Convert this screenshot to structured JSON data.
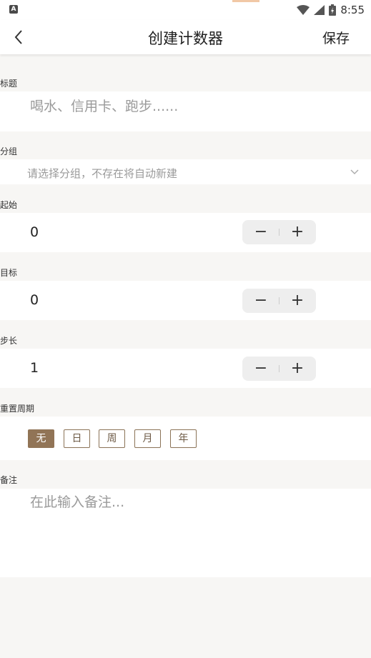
{
  "status_bar": {
    "time": "8:55",
    "left_icon": "A",
    "icons": [
      "wifi-icon",
      "signal-icon",
      "battery-icon"
    ]
  },
  "app_bar": {
    "title": "创建计数器",
    "save_label": "保存",
    "back_icon": "chevron-left-icon"
  },
  "form": {
    "title": {
      "label": "标题",
      "placeholder": "喝水、信用卡、跑步......"
    },
    "group": {
      "label": "分组",
      "placeholder": "请选择分组，不存在将自动新建"
    },
    "start": {
      "label": "起始",
      "value": "0"
    },
    "target": {
      "label": "目标",
      "value": "0"
    },
    "step": {
      "label": "步长",
      "value": "1"
    },
    "reset_period": {
      "label": "重置周期",
      "options": [
        "无",
        "日",
        "周",
        "月",
        "年"
      ],
      "selected": "无"
    },
    "note": {
      "label": "备注",
      "placeholder": "在此输入备注..."
    }
  },
  "stepper": {
    "minus": "−",
    "plus": "+"
  },
  "colors": {
    "accent": "#917456",
    "background": "#f7f6f4"
  }
}
